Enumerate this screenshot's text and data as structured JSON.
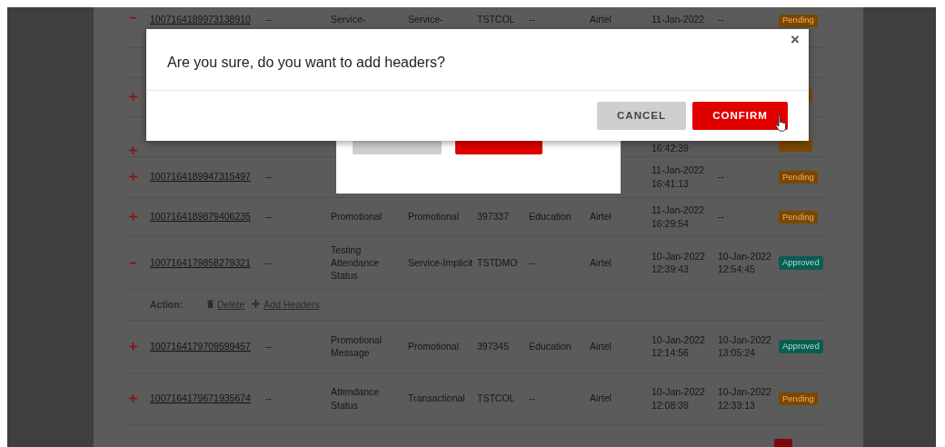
{
  "table": {
    "rows": [
      {
        "kind": "record",
        "expanded": true,
        "id": "1007164189973138910",
        "cells": {
          "column_2": "--",
          "column_3": "Service-",
          "column_4": "Service-",
          "column_5": "TSTCOL",
          "column_6": "--",
          "column_7": "Airtel",
          "column_8": "11-Jan-2022",
          "column_9": "--"
        },
        "status": {
          "kind": "pending",
          "label": "Pending"
        }
      },
      {
        "kind": "actions"
      },
      {
        "kind": "record",
        "expanded": false,
        "cells": {},
        "status": {
          "kind": "pending"
        }
      },
      {
        "kind": "record",
        "expanded": false,
        "cells": {
          "column_8": "16:42:39"
        },
        "status": {
          "kind": "pending"
        }
      },
      {
        "kind": "record",
        "expanded": false,
        "id": "1007164189947315497",
        "cells": {
          "column_2": "--",
          "column_8": "11-Jan-2022 16:41:13",
          "column_9": "--"
        },
        "status": {
          "kind": "pending",
          "label": "Pending"
        }
      },
      {
        "kind": "record",
        "expanded": false,
        "id": "1007164189879406235",
        "cells": {
          "column_2": "--",
          "column_3": "Promotional",
          "column_4": "Promotional",
          "column_5": "397337",
          "column_6": "Education",
          "column_7": "Airtel",
          "column_8": "11-Jan-2022 16:29:54",
          "column_9": "--"
        },
        "status": {
          "kind": "pending",
          "label": "Pending"
        }
      },
      {
        "kind": "record",
        "expanded": true,
        "id": "1007164179858279321",
        "cells": {
          "column_2": "--",
          "column_3": "Testing Attendance Status",
          "column_4": "Service-Implicit",
          "column_5": "TSTDMO",
          "column_6": "--",
          "column_7": "Airtel",
          "column_8": "10-Jan-2022 12:39:43",
          "column_9": "10-Jan-2022 12:54:45"
        },
        "status": {
          "kind": "approved",
          "label": "Approved"
        }
      },
      {
        "kind": "actions",
        "label": "Action:",
        "links": [
          {
            "kind": "delete",
            "label": "Delete"
          },
          {
            "kind": "add",
            "label": "Add Headers"
          }
        ]
      },
      {
        "kind": "record",
        "expanded": false,
        "id": "1007164179709599457",
        "cells": {
          "column_2": "--",
          "column_3": "Promotional Message",
          "column_4": "Promotional",
          "column_5": "397345",
          "column_6": "Education",
          "column_7": "Airtel",
          "column_8": "10-Jan-2022 12:14:56",
          "column_9": "10-Jan-2022 13:05:24"
        },
        "status": {
          "kind": "approved",
          "label": "Approved"
        }
      },
      {
        "kind": "record",
        "expanded": false,
        "id": "1007164179671935674",
        "cells": {
          "column_2": "--",
          "column_3": "Attendance Status",
          "column_4": "Transactional",
          "column_5": "TSTCOL",
          "column_6": "--",
          "column_7": "Airtel",
          "column_8": "10-Jan-2022 12:08:39",
          "column_9": "10-Jan-2022 12:33:13"
        },
        "status": {
          "kind": "pending",
          "label": "Pending"
        }
      }
    ]
  },
  "confirm_dialog": {
    "message": "Are you sure, do you want to add headers?",
    "close_label": "×",
    "buttons": [
      {
        "kind": "cancel",
        "label": "CANCEL"
      },
      {
        "kind": "confirm",
        "label": "CONFIRM",
        "hovered": true
      }
    ]
  },
  "back_dialog": {
    "buttons": [
      {
        "kind": "cancel"
      },
      {
        "kind": "submit"
      }
    ]
  }
}
